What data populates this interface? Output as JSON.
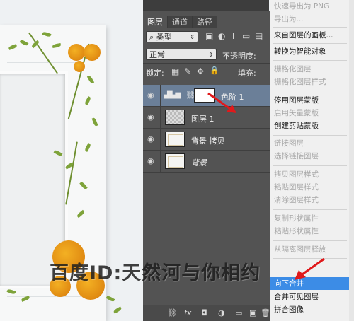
{
  "layers_panel": {
    "tabs": [
      "图层",
      "通道",
      "路径"
    ],
    "filter": {
      "label": "类型"
    },
    "filter_icons": [
      "▣",
      "◐",
      "T",
      "▭",
      "▤"
    ],
    "blend_mode": "正常",
    "opacity_label": "不透明度:",
    "lock_label": "锁定:",
    "lock_icons": [
      "▦",
      "✎",
      "✥",
      "🔒"
    ],
    "fill_label": "填充:",
    "layers": [
      {
        "name": "色阶 1",
        "type": "adjustment",
        "selected": true
      },
      {
        "name": "图层 1",
        "type": "transparent",
        "selected": false
      },
      {
        "name": "背景 拷贝",
        "type": "photo",
        "selected": false
      },
      {
        "name": "背景",
        "type": "photo",
        "selected": false,
        "italic": true
      }
    ],
    "bottom_icons": [
      "⛓",
      "fx",
      "◘",
      "◑",
      "▭",
      "▣",
      "🗑"
    ]
  },
  "context_menu": {
    "items": [
      {
        "label": "快速导出为 PNG",
        "enabled": false
      },
      {
        "label": "导出为...",
        "enabled": false
      },
      {
        "label": "来自图层的画板...",
        "enabled": true
      },
      {
        "label": "转换为智能对象",
        "enabled": true
      },
      {
        "label": "栅格化图层",
        "enabled": false
      },
      {
        "label": "栅格化图层样式",
        "enabled": false
      },
      {
        "label": "停用图层蒙版",
        "enabled": true
      },
      {
        "label": "启用矢量蒙版",
        "enabled": false
      },
      {
        "label": "创建剪贴蒙版",
        "enabled": true
      },
      {
        "label": "链接图层",
        "enabled": false
      },
      {
        "label": "选择链接图层",
        "enabled": false
      },
      {
        "label": "拷贝图层样式",
        "enabled": false
      },
      {
        "label": "粘贴图层样式",
        "enabled": false
      },
      {
        "label": "清除图层样式",
        "enabled": false
      },
      {
        "label": "复制形状属性",
        "enabled": false
      },
      {
        "label": "粘贴形状属性",
        "enabled": false
      },
      {
        "label": "从隔离图层释放",
        "enabled": false
      },
      {
        "label": "向下合并",
        "enabled": true,
        "highlighted": true
      },
      {
        "label": "合并可见图层",
        "enabled": true
      },
      {
        "label": "拼合图像",
        "enabled": true
      }
    ]
  },
  "watermark": "百度ID:天然河与你相约",
  "colors": {
    "panel_bg": "#535353",
    "selected_layer": "#6b7f98",
    "menu_highlight": "#3c8ce6",
    "arrow_red": "#e0191b"
  }
}
